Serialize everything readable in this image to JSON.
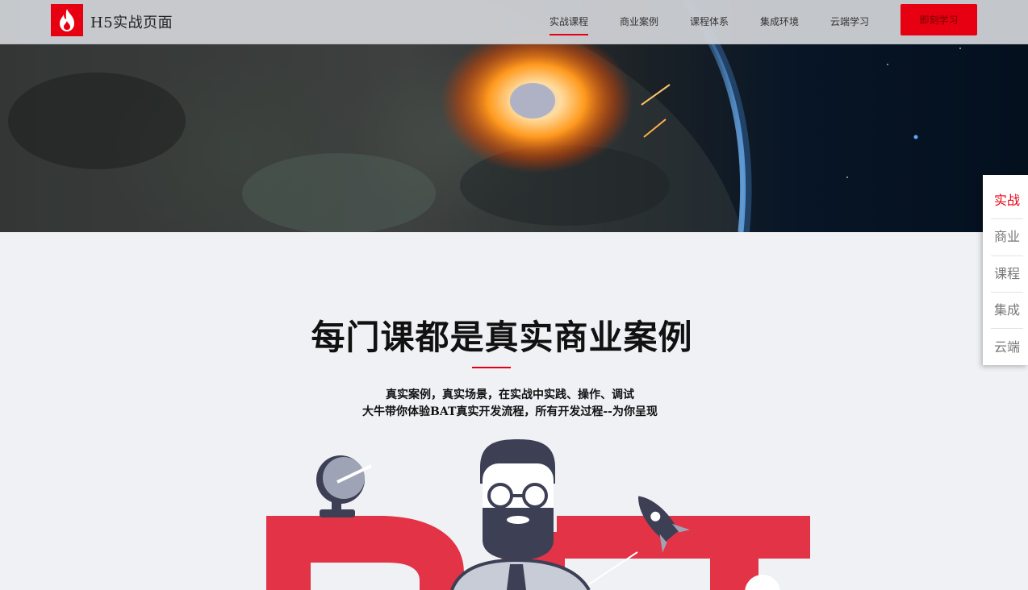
{
  "brand": {
    "name": "H5实战页面",
    "logo_icon": "flame-icon",
    "color": "#e60012"
  },
  "nav": {
    "items": [
      {
        "label": "实战课程",
        "active": true
      },
      {
        "label": "商业案例",
        "active": false
      },
      {
        "label": "课程体系",
        "active": false
      },
      {
        "label": "集成环境",
        "active": false
      },
      {
        "label": "云端学习",
        "active": false
      }
    ],
    "cta_label": "即刻学习"
  },
  "side_nav": {
    "items": [
      {
        "label": "实战",
        "active": true
      },
      {
        "label": "商业",
        "active": false
      },
      {
        "label": "课程",
        "active": false
      },
      {
        "label": "集成",
        "active": false
      },
      {
        "label": "云端",
        "active": false
      }
    ]
  },
  "section": {
    "title": "每门课都是真实商业案例",
    "desc_line1": "真实案例，真实场景，在实战中实践、操作、调试",
    "desc_line2": "大牛带你体验BAT真实开发流程，所有开发过程--为你呈现"
  },
  "colors": {
    "accent": "#e60012",
    "illustration_red": "#e23347",
    "illustration_dark": "#3d3f55"
  }
}
